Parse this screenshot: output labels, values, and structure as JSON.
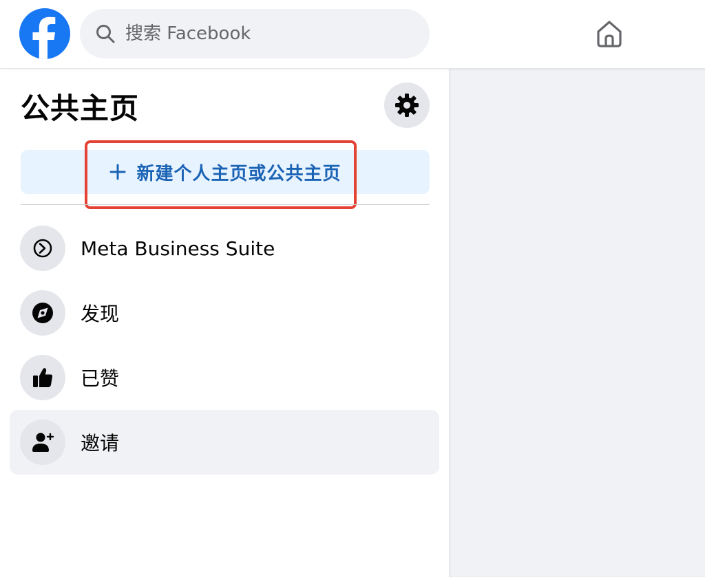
{
  "header": {
    "search": {
      "placeholder": "搜索 Facebook",
      "value": ""
    },
    "icons": {
      "logo": "facebook-logo",
      "search": "search-icon",
      "home": "home-icon"
    },
    "brand_color": "#1877f2"
  },
  "sidebar": {
    "title": "公共主页",
    "settings_icon": "gear-icon",
    "create_button": {
      "label": "新建个人主页或公共主页",
      "icon": "plus-icon",
      "highlight_color": "#e34234"
    },
    "items": [
      {
        "label": "Meta Business Suite",
        "icon": "meta-business-suite-icon",
        "active": false
      },
      {
        "label": "发现",
        "icon": "compass-icon",
        "active": false
      },
      {
        "label": "已赞",
        "icon": "thumbs-up-icon",
        "active": false
      },
      {
        "label": "邀请",
        "icon": "person-add-icon",
        "active": true
      }
    ]
  }
}
